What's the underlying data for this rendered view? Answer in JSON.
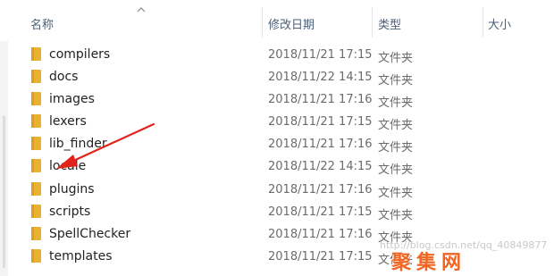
{
  "columns": {
    "name": "名称",
    "modified": "修改日期",
    "type": "类型",
    "size": "大小"
  },
  "rows": [
    {
      "name": "compilers",
      "modified": "2018/11/21 17:15",
      "type": "文件夹"
    },
    {
      "name": "docs",
      "modified": "2018/11/22 14:15",
      "type": "文件夹"
    },
    {
      "name": "images",
      "modified": "2018/11/21 17:16",
      "type": "文件夹"
    },
    {
      "name": "lexers",
      "modified": "2018/11/21 17:15",
      "type": "文件夹"
    },
    {
      "name": "lib_finder",
      "modified": "2018/11/21 17:16",
      "type": "文件夹"
    },
    {
      "name": "locale",
      "modified": "2018/11/22 14:15",
      "type": "文件夹"
    },
    {
      "name": "plugins",
      "modified": "2018/11/21 17:16",
      "type": "文件夹"
    },
    {
      "name": "scripts",
      "modified": "2018/11/21 17:15",
      "type": "文件夹"
    },
    {
      "name": "SpellChecker",
      "modified": "2018/11/21 17:16",
      "type": "文件夹"
    },
    {
      "name": "templates",
      "modified": "2018/11/21 17:15",
      "type": "文件夹"
    }
  ],
  "icons": {
    "folder": "folder-icon",
    "sort": "sort-ascending-icon"
  },
  "colors": {
    "folder": "#e8b12f",
    "folder_tab": "#d9a024",
    "annotation_arrow": "#e2231a",
    "header_text": "#4c607a"
  },
  "watermark": {
    "text": "http://blog.csdn.net/qq_40849877",
    "logo": "聚集网"
  }
}
